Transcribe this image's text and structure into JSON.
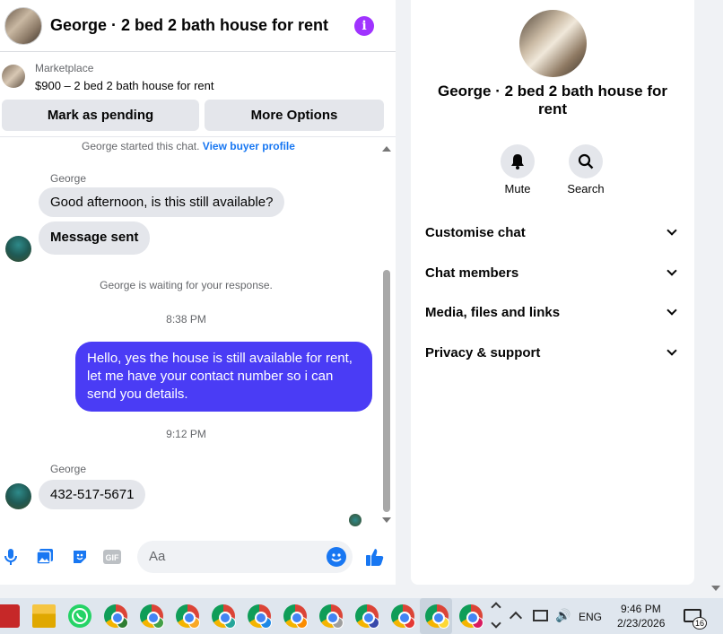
{
  "header": {
    "title": "George · 2 bed 2 bath house for rent"
  },
  "marketplace": {
    "label": "Marketplace",
    "item": "$900 – 2 bed 2 bath house for rent"
  },
  "actions": {
    "pending": "Mark as pending",
    "more": "More Options"
  },
  "messages": {
    "started": "George started this chat.",
    "buyer_profile": "View buyer profile",
    "sender1": "George",
    "msg1": "Good afternoon, is this still available?",
    "msg2": "Message sent",
    "waiting": "George is waiting for your response.",
    "time1": "8:38 PM",
    "reply": "Hello, yes the house is still available for rent, let me have your contact number so i can send you details.",
    "time2": "9:12 PM",
    "sender2": "George",
    "msg3": "432-517-5671"
  },
  "composer": {
    "placeholder": "Aa"
  },
  "info": {
    "title": "George · 2 bed 2 bath house for rent",
    "mute": "Mute",
    "search": "Search",
    "rows": [
      "Customise chat",
      "Chat members",
      "Media, files and links",
      "Privacy & support"
    ]
  },
  "taskbar": {
    "lang": "ENG",
    "time": "9:46 PM",
    "date": "2/23/2026",
    "notif_count": "16"
  },
  "colors": {
    "accent": "#1877f2",
    "outgoing": "#4a3cf5",
    "info": "#a033ff"
  }
}
